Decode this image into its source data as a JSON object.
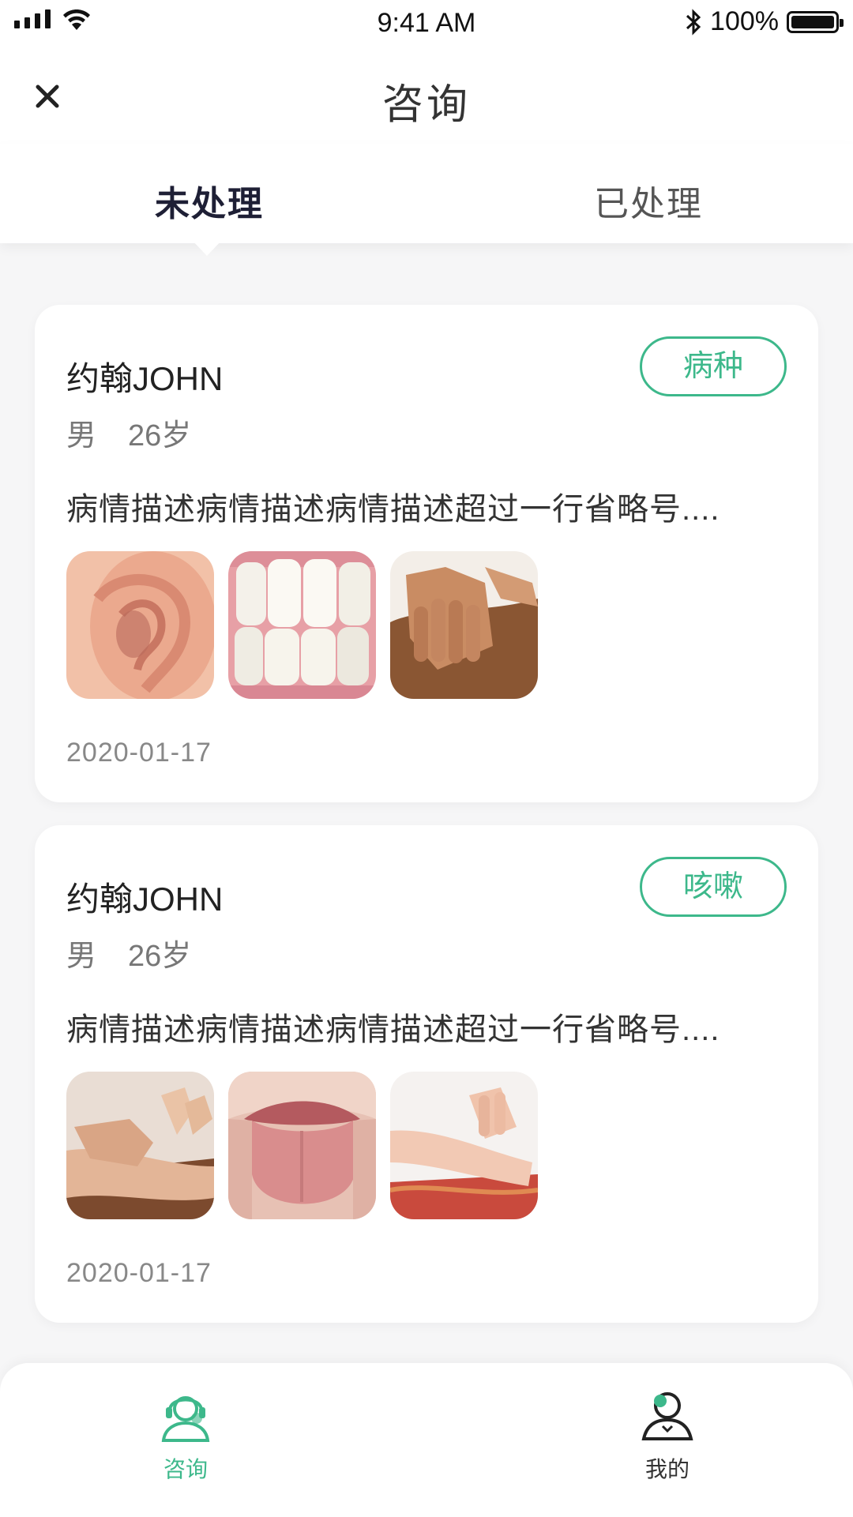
{
  "status_bar": {
    "time": "9:41 AM",
    "battery": "100%"
  },
  "nav": {
    "title": "咨询"
  },
  "tabs": [
    {
      "label": "未处理",
      "active": true
    },
    {
      "label": "已处理",
      "active": false
    }
  ],
  "consultations": [
    {
      "name": "约翰JOHN",
      "gender": "男",
      "age": "26岁",
      "tag": "病种",
      "description": "病情描述病情描述病情描述超过一行省略号....",
      "images": [
        "ear",
        "teeth",
        "hands-massage"
      ],
      "date": "2020-01-17"
    },
    {
      "name": "约翰JOHN",
      "gender": "男",
      "age": "26岁",
      "tag": "咳嗽",
      "description": "病情描述病情描述病情描述超过一行省略号....",
      "images": [
        "pulse-taking",
        "tongue",
        "wrist-pulse"
      ],
      "date": "2020-01-17"
    }
  ],
  "bottom_nav": [
    {
      "label": "咨询",
      "icon": "consult-headset-icon",
      "active": true
    },
    {
      "label": "我的",
      "icon": "profile-icon",
      "active": false
    }
  ],
  "colors": {
    "accent": "#3db88b",
    "text_dark": "#1e1f35",
    "background": "#f6f6f7"
  }
}
